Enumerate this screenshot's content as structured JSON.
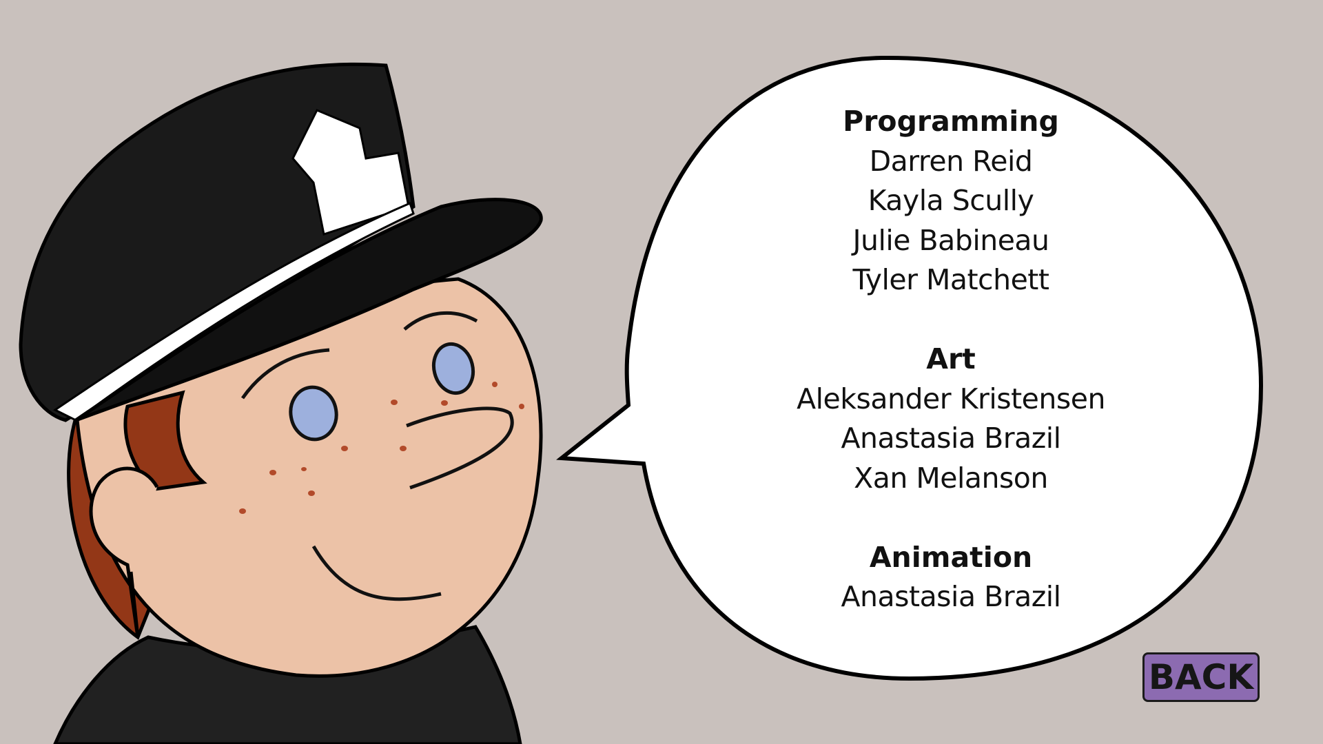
{
  "credits": {
    "sections": [
      {
        "heading": "Programming",
        "names": [
          "Darren Reid",
          "Kayla Scully",
          "Julie Babineau",
          "Tyler Matchett"
        ]
      },
      {
        "heading": "Art",
        "names": [
          "Aleksander Kristensen",
          "Anastasia Brazil",
          "Xan Melanson"
        ]
      },
      {
        "heading": "Animation",
        "names": [
          "Anastasia Brazil"
        ]
      }
    ]
  },
  "back_button": {
    "label": "BACK"
  },
  "colors": {
    "background": "#c9c1bd",
    "skin": "#ecc2a7",
    "hair": "#933717",
    "hat": "#1a1a1a",
    "eyes": "#9db0dd",
    "freckles": "#b24a2a",
    "button": "#8c6bb1",
    "bubble": "#ffffff"
  }
}
